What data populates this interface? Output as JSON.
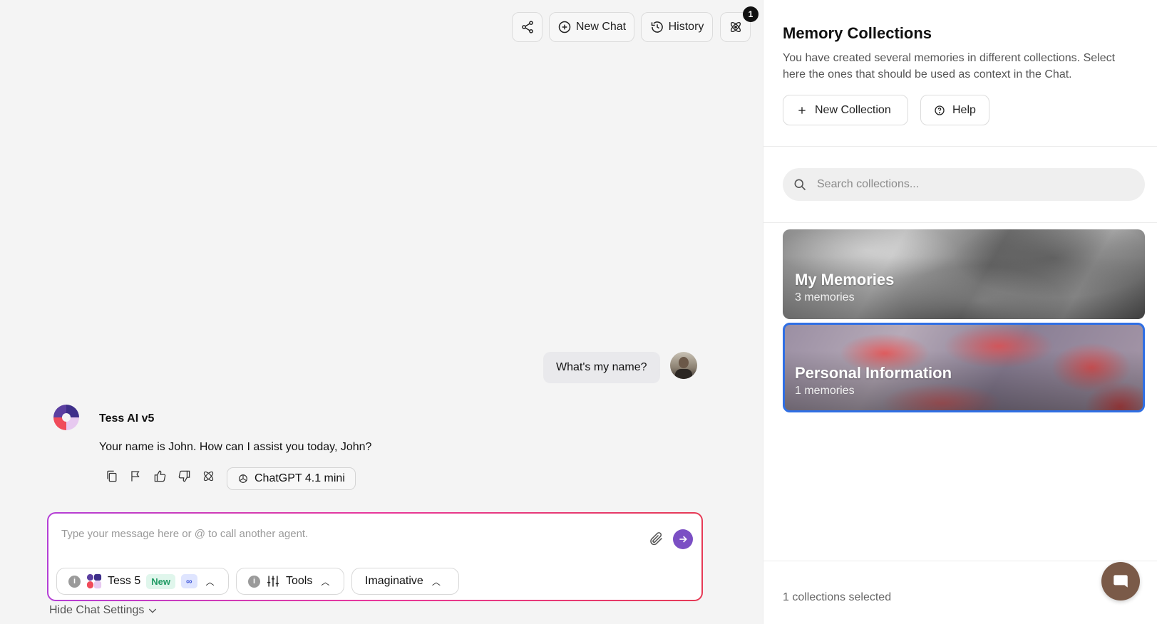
{
  "topbar": {
    "new_chat_label": "New Chat",
    "history_label": "History",
    "notification_count": "1"
  },
  "conversation": {
    "user_message": "What's my name?",
    "assistant_name": "Tess AI v5",
    "assistant_message": "Your name is John. How can I assist you today, John?",
    "model_label": "ChatGPT 4.1 mini"
  },
  "composer": {
    "placeholder": "Type your message here or @ to call another agent.",
    "agent_label": "Tess 5",
    "new_tag": "New",
    "infinity_tag": "∞",
    "tools_label": "Tools",
    "mode_label": "Imaginative",
    "hide_settings_label": "Hide Chat Settings"
  },
  "panel": {
    "title": "Memory Collections",
    "description": "You have created several memories in different collections. Select here the ones that should be used as context in the Chat.",
    "new_collection_label": "New Collection",
    "help_label": "Help",
    "search_placeholder": "Search collections...",
    "collections": [
      {
        "name": "My Memories",
        "count": "3 memories",
        "selected": false
      },
      {
        "name": "Personal Information",
        "count": "1 memories",
        "selected": true
      }
    ],
    "selected_count_text": "1 collections selected"
  },
  "colors": {
    "accent": "#7b4fc4",
    "selected_border": "#2f6fe4",
    "support_bubble": "#7a5a48"
  }
}
